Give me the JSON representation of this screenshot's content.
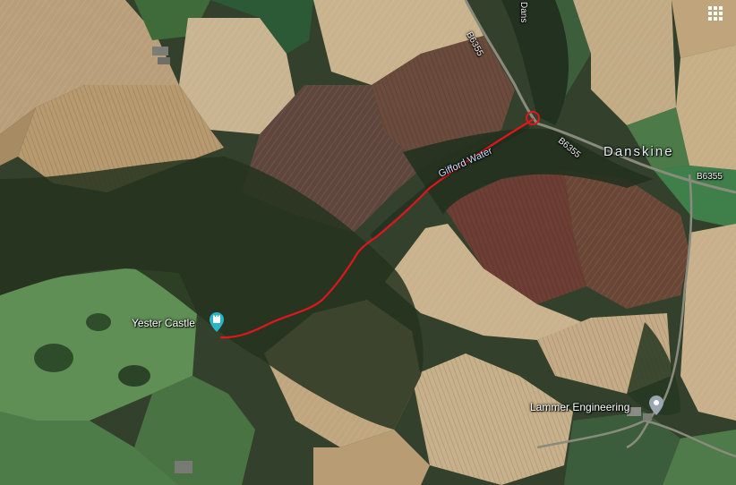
{
  "map": {
    "type": "satellite",
    "place_label": "Danskine",
    "water_label": "Gifford Water",
    "roads": [
      "B6355",
      "B6355",
      "B6355"
    ],
    "road_side_label": "Dans",
    "pois": [
      {
        "name": "Yester Castle",
        "icon": "castle-pin-icon",
        "color": "#2ab4c7"
      },
      {
        "name": "Lammer Engineering",
        "icon": "place-pin-icon",
        "color": "#9aa6b0"
      }
    ],
    "route": {
      "color": "#e0161a"
    },
    "controls": {
      "apps_icon": "grid-icon"
    }
  }
}
